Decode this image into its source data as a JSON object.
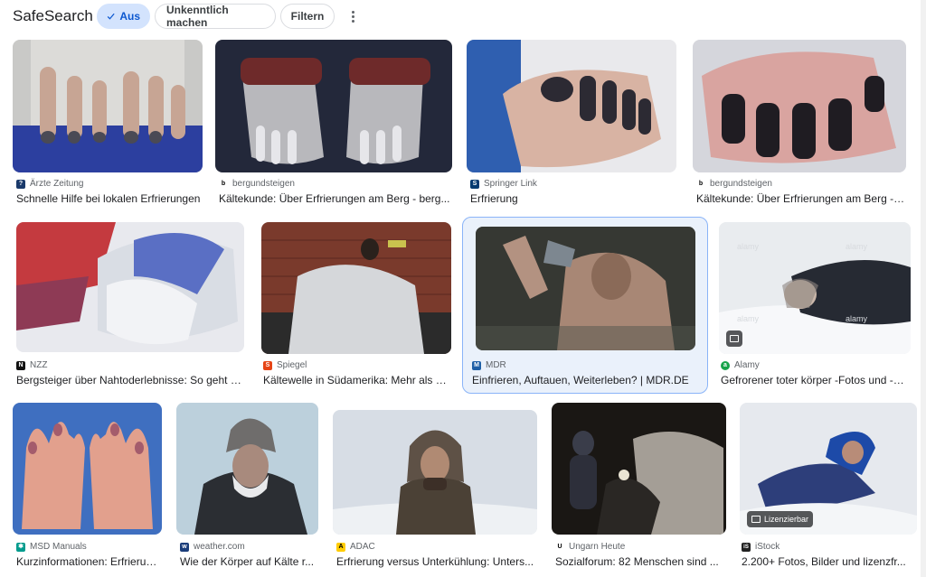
{
  "toolbar": {
    "title": "SafeSearch",
    "safesearch_state": "Aus",
    "blur_label": "Unkenntlich machen",
    "filter_label": "Filtern"
  },
  "results": [
    {
      "source": "Ärzte Zeitung",
      "title": "Schnelle Hilfe bei lokalen Erfrierungen",
      "favicon_color": "#1a3a6b",
      "favicon_char": "?"
    },
    {
      "source": "bergundsteigen",
      "title": "Kältekunde: Über Erfrierungen am Berg - berg...",
      "favicon_color": "#ffffff",
      "favicon_char": "b"
    },
    {
      "source": "Springer Link",
      "title": "Erfrierung",
      "favicon_color": "#003a70",
      "favicon_char": "S"
    },
    {
      "source": "bergundsteigen",
      "title": "Kältekunde: Über Erfrierungen am Berg - b...",
      "favicon_color": "#ffffff",
      "favicon_char": "b"
    },
    {
      "source": "NZZ",
      "title": "Bergsteiger über Nahtoderlebnisse: So geht e...",
      "favicon_color": "#111111",
      "favicon_char": "N"
    },
    {
      "source": "Spiegel",
      "title": "Kältewelle in Südamerika: Mehr als h...",
      "favicon_color": "#e64415",
      "favicon_char": "S"
    },
    {
      "source": "MDR",
      "title": "Einfrieren, Auftauen, Weiterleben? | MDR.DE",
      "favicon_color": "#1f5fa6",
      "favicon_char": "M"
    },
    {
      "source": "Alamy",
      "title": "Gefrorener toter körper -Fotos und -Bil...",
      "favicon_color": "#17a34a",
      "favicon_char": "a"
    },
    {
      "source": "MSD Manuals",
      "title": "Kurzinformationen: Erfrierun...",
      "favicon_color": "#009b8d",
      "favicon_char": "✱"
    },
    {
      "source": "weather.com",
      "title": "Wie der Körper auf Kälte r...",
      "favicon_color": "#1b3d7a",
      "favicon_char": "w"
    },
    {
      "source": "ADAC",
      "title": "Erfrierung versus Unterkühlung: Unters...",
      "favicon_color": "#ffcc00",
      "favicon_char": "A"
    },
    {
      "source": "Ungarn Heute",
      "title": "Sozialforum: 82 Menschen sind ...",
      "favicon_color": "#ffffff",
      "favicon_char": "U"
    },
    {
      "source": "iStock",
      "title": "2.200+ Fotos, Bilder und lizenzfr...",
      "favicon_color": "#222222",
      "favicon_char": "iS",
      "badge": "Lizenzierbar"
    }
  ]
}
